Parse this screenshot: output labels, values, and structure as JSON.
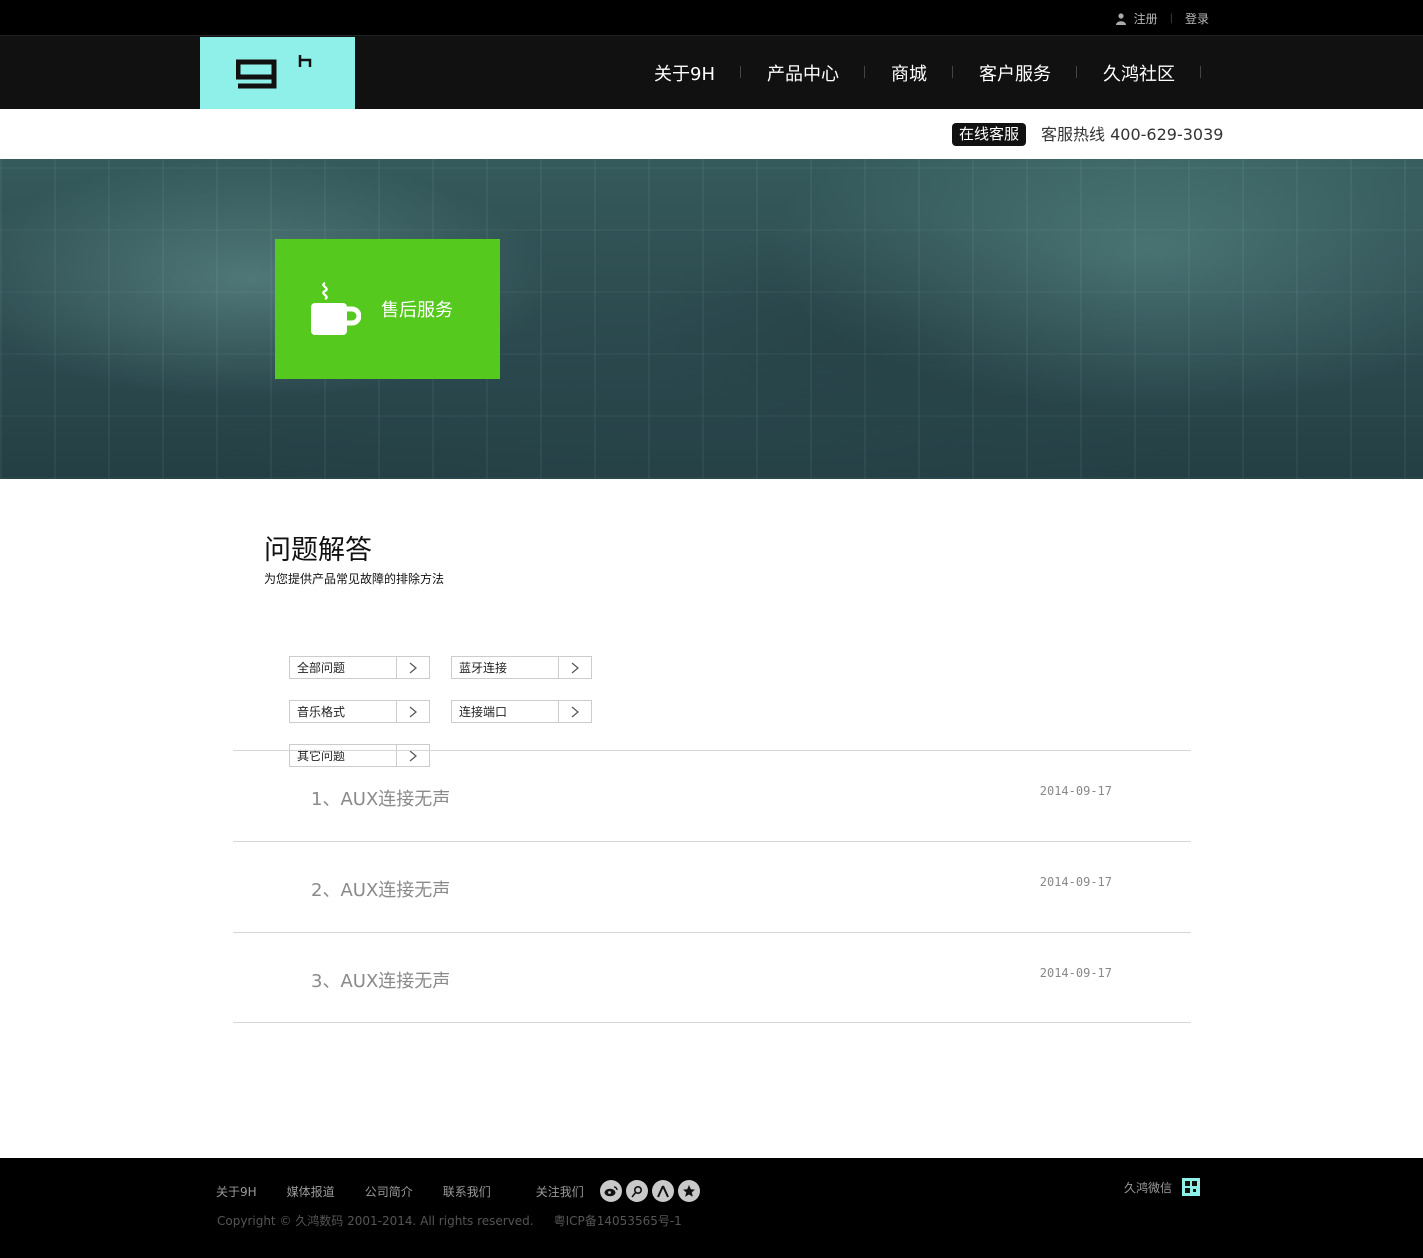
{
  "topbar": {
    "register_label": "注册",
    "login_label": "登录"
  },
  "header": {
    "nav": [
      {
        "label": "关于9H"
      },
      {
        "label": "产品中心"
      },
      {
        "label": "商城"
      },
      {
        "label": "客户服务"
      },
      {
        "label": "久鸿社区"
      }
    ]
  },
  "hotline": {
    "online_label": "在线客服",
    "phone_label": "客服热线 400-629-3039"
  },
  "banner": {
    "card_label": "售后服务"
  },
  "qa": {
    "title": "问题解答",
    "subtitle": "为您提供产品常见故障的排除方法",
    "filters": [
      "全部问题",
      "蓝牙连接",
      "音乐格式",
      "连接端口",
      "其它问题"
    ],
    "items": [
      {
        "question": "1、AUX连接无声",
        "date": "2014-09-17"
      },
      {
        "question": "2、AUX连接无声",
        "date": "2014-09-17"
      },
      {
        "question": "3、AUX连接无声",
        "date": "2014-09-17"
      }
    ]
  },
  "footer": {
    "links": [
      "关于9H",
      "媒体报道",
      "公司简介",
      "联系我们"
    ],
    "follow_label": "关注我们",
    "social_icons": [
      "weibo-icon",
      "tencent-weibo-icon",
      "renren-icon",
      "star-icon"
    ],
    "copyright": "Copyright © 久鸿数码 2001-2014. All rights reserved.",
    "icp": "粤ICP备14053565号-1",
    "wechat_label": "久鸿微信"
  },
  "colors": {
    "logo_bg": "#8ff0ea",
    "service_card": "#55c91e",
    "header_bg": "#111111"
  }
}
